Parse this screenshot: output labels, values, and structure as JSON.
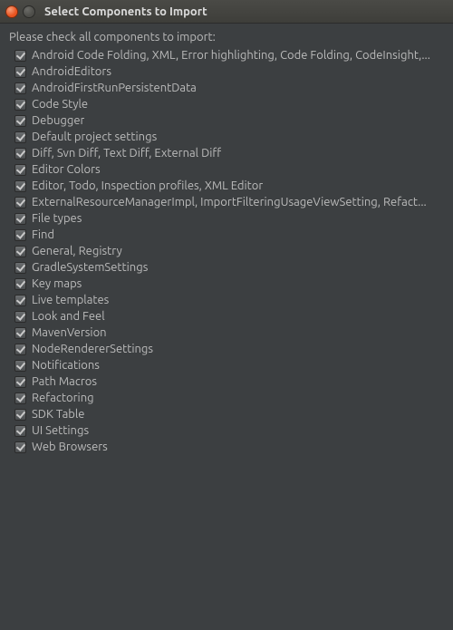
{
  "window": {
    "title": "Select Components to Import"
  },
  "instruction": "Please check all components to import:",
  "components": [
    {
      "label": "Android Code Folding, XML, Error highlighting, Code Folding, CodeInsight,...",
      "checked": true
    },
    {
      "label": "AndroidEditors",
      "checked": true
    },
    {
      "label": "AndroidFirstRunPersistentData",
      "checked": true
    },
    {
      "label": "Code Style",
      "checked": true
    },
    {
      "label": "Debugger",
      "checked": true
    },
    {
      "label": "Default project settings",
      "checked": true
    },
    {
      "label": "Diff, Svn Diff, Text Diff, External Diff",
      "checked": true
    },
    {
      "label": "Editor Colors",
      "checked": true
    },
    {
      "label": "Editor, Todo, Inspection profiles, XML Editor",
      "checked": true
    },
    {
      "label": "ExternalResourceManagerImpl, ImportFilteringUsageViewSetting, Refact...",
      "checked": true
    },
    {
      "label": "File types",
      "checked": true
    },
    {
      "label": "Find",
      "checked": true
    },
    {
      "label": "General, Registry",
      "checked": true
    },
    {
      "label": "GradleSystemSettings",
      "checked": true
    },
    {
      "label": "Key maps",
      "checked": true
    },
    {
      "label": "Live templates",
      "checked": true
    },
    {
      "label": "Look and Feel",
      "checked": true
    },
    {
      "label": "MavenVersion",
      "checked": true
    },
    {
      "label": "NodeRendererSettings",
      "checked": true
    },
    {
      "label": "Notifications",
      "checked": true
    },
    {
      "label": "Path Macros",
      "checked": true
    },
    {
      "label": "Refactoring",
      "checked": true
    },
    {
      "label": "SDK Table",
      "checked": true
    },
    {
      "label": "UI Settings",
      "checked": true
    },
    {
      "label": "Web Browsers",
      "checked": true
    }
  ]
}
